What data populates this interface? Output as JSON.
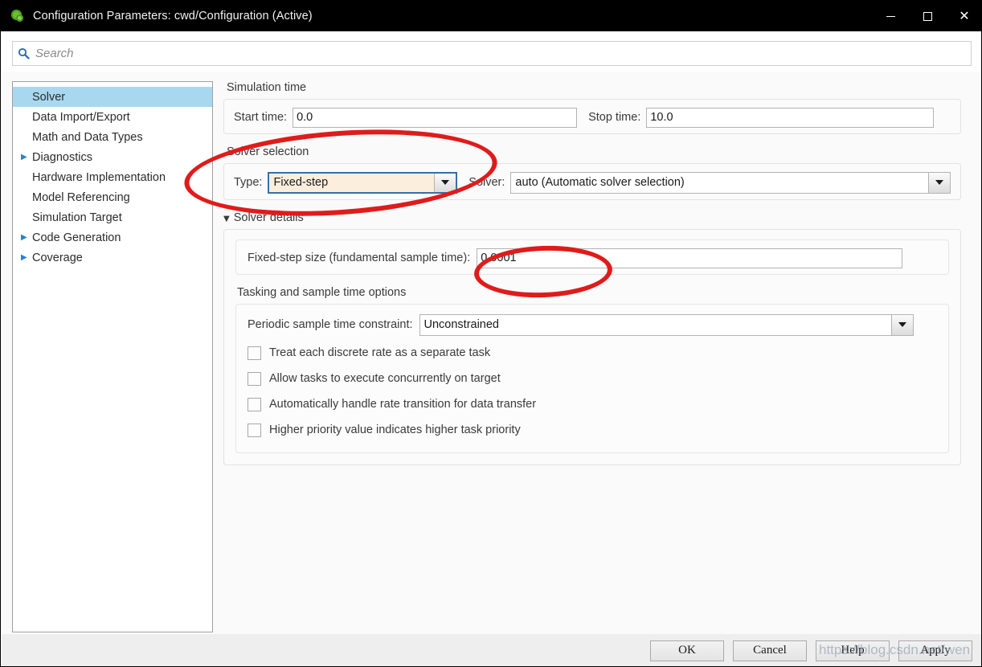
{
  "window": {
    "title": "Configuration Parameters: cwd/Configuration (Active)",
    "icon": "simulink-gear-icon",
    "minimize_label": "",
    "maximize_label": "",
    "close_label": "✕"
  },
  "search": {
    "placeholder": "Search",
    "value": "",
    "icon": "search-icon"
  },
  "sidebar": {
    "items": [
      {
        "label": "Solver",
        "expandable": false,
        "selected": true
      },
      {
        "label": "Data Import/Export",
        "expandable": false,
        "selected": false
      },
      {
        "label": "Math and Data Types",
        "expandable": false,
        "selected": false
      },
      {
        "label": "Diagnostics",
        "expandable": true,
        "selected": false
      },
      {
        "label": "Hardware Implementation",
        "expandable": false,
        "selected": false
      },
      {
        "label": "Model Referencing",
        "expandable": false,
        "selected": false
      },
      {
        "label": "Simulation Target",
        "expandable": false,
        "selected": false
      },
      {
        "label": "Code Generation",
        "expandable": true,
        "selected": false
      },
      {
        "label": "Coverage",
        "expandable": true,
        "selected": false
      }
    ]
  },
  "main": {
    "simulation_time": {
      "group_label": "Simulation time",
      "start_time_label": "Start time:",
      "start_time_value": "0.0",
      "stop_time_label": "Stop time:",
      "stop_time_value": "10.0"
    },
    "solver_selection": {
      "group_label": "Solver selection",
      "type_label": "Type:",
      "type_value": "Fixed-step",
      "solver_label": "Solver:",
      "solver_value": "auto (Automatic solver selection)"
    },
    "solver_details": {
      "group_label": "Solver details",
      "caret": "▼",
      "fixed_step_label": "Fixed-step size (fundamental sample time):",
      "fixed_step_value": "0.0001",
      "tasking_label": "Tasking and sample time options",
      "periodic_label": "Periodic sample time constraint:",
      "periodic_value": "Unconstrained",
      "checkboxes": [
        {
          "label": "Treat each discrete rate as a separate task",
          "checked": false
        },
        {
          "label": "Allow tasks to execute concurrently on target",
          "checked": false
        },
        {
          "label": "Automatically handle rate transition for data transfer",
          "checked": false
        },
        {
          "label": "Higher priority value indicates higher task priority",
          "checked": false
        }
      ]
    }
  },
  "footer": {
    "ok_label": "OK",
    "cancel_label": "Cancel",
    "help_label": "Help",
    "apply_label": "Apply"
  },
  "overlay": {
    "watermark": "https://blog.csdn.net/wen",
    "highlight_color": "#e01b1b"
  }
}
